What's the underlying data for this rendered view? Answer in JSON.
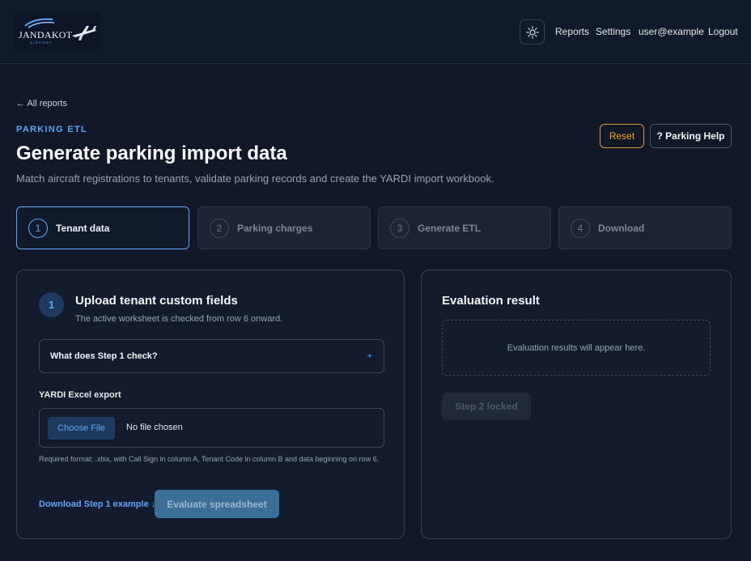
{
  "header": {
    "logo_text": "JANDAKOT",
    "logo_subtext": "AIRPORT",
    "theme_icon": "sun-icon",
    "nav": {
      "reports": "Reports",
      "settings": "Settings",
      "user": "user@example",
      "logout": "Logout"
    }
  },
  "page": {
    "back_link": "← All reports",
    "eyebrow": "PARKING ETL",
    "title": "Generate parking import data",
    "subtitle": "Match aircraft registrations to tenants, validate parking records and create the YARDI import workbook.",
    "reset_label": "Reset",
    "help_label": "? Parking Help"
  },
  "steps": [
    {
      "number": "1",
      "label": "Tenant data",
      "active": true
    },
    {
      "number": "2",
      "label": "Parking charges",
      "active": false
    },
    {
      "number": "3",
      "label": "Generate ETL",
      "active": false
    },
    {
      "number": "4",
      "label": "Download",
      "active": false
    }
  ],
  "upload": {
    "step_number": "1",
    "title": "Upload tenant custom fields",
    "subtitle": "The active worksheet is checked from row 6 onward.",
    "accordion_label": "What does Step 1 check?",
    "accordion_icon": "+",
    "field_label": "YARDI Excel export",
    "choose_file_label": "Choose File",
    "file_status": "No file chosen",
    "help_text": "Required format: .xlsx, with Call Sign in column A, Tenant Code in column B and data beginning on row 6.",
    "download_example": "Download Step 1 example ↓",
    "evaluate_label": "Evaluate spreadsheet"
  },
  "evaluation": {
    "title": "Evaluation result",
    "empty_text": "Evaluation results will appear here.",
    "locked_label": "Step 2 locked"
  },
  "colors": {
    "background": "#111827",
    "accent": "#60a5fa",
    "warning": "#f5a524"
  }
}
